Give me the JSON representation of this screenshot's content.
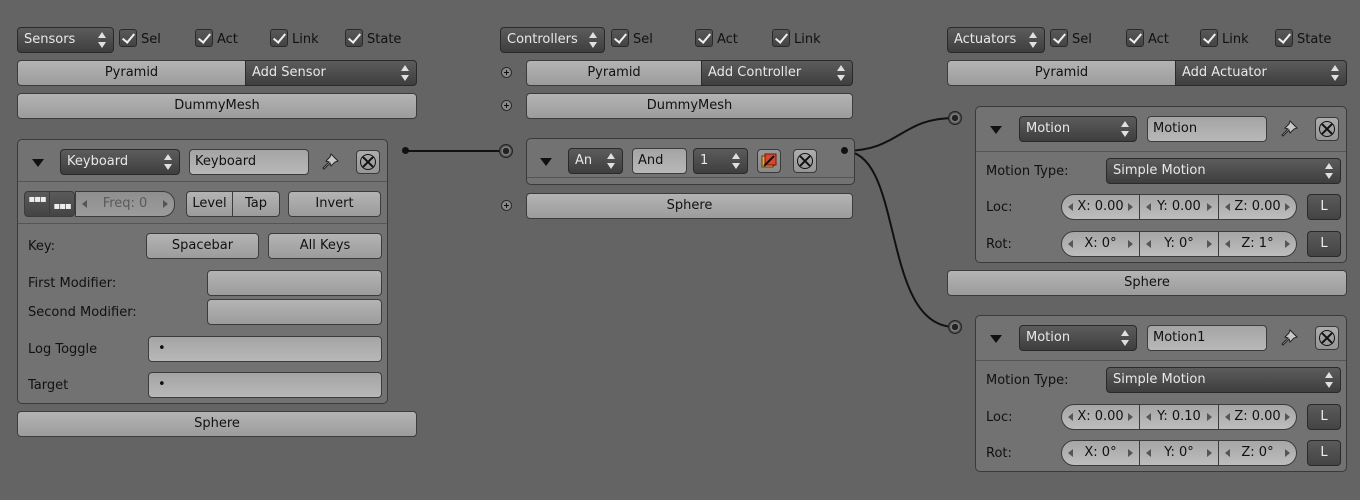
{
  "sensors": {
    "menu": "Sensors",
    "filters": [
      "Sel",
      "Act",
      "Link",
      "State"
    ],
    "object_name": "Pyramid",
    "add_menu": "Add Sensor",
    "object2": "DummyMesh",
    "object3": "Sphere",
    "brick": {
      "type": "Keyboard",
      "name": "Keyboard",
      "freq": "Freq: 0",
      "level": "Level",
      "tap": "Tap",
      "invert": "Invert",
      "key_label": "Key:",
      "key_value": "Spacebar",
      "all_keys": "All Keys",
      "first_modifier": "First Modifier:",
      "second_modifier": "Second Modifier:",
      "log_toggle": "Log Toggle",
      "target": "Target",
      "bullet": "•"
    }
  },
  "controllers": {
    "menu": "Controllers",
    "filters": [
      "Sel",
      "Act",
      "Link"
    ],
    "object_name": "Pyramid",
    "add_menu": "Add Controller",
    "object2": "DummyMesh",
    "object3": "Sphere",
    "brick": {
      "type": "An",
      "name": "And",
      "state": "1"
    }
  },
  "actuators": {
    "menu": "Actuators",
    "filters": [
      "Sel",
      "Act",
      "Link",
      "State"
    ],
    "object_name": "Pyramid",
    "add_menu": "Add Actuator",
    "object2": "Sphere",
    "bricks": [
      {
        "type": "Motion",
        "name": "Motion",
        "motion_type_label": "Motion Type:",
        "motion_type": "Simple Motion",
        "loc_label": "Loc:",
        "loc": [
          "X: 0.00",
          "Y: 0.00",
          "Z: 0.00"
        ],
        "rot_label": "Rot:",
        "rot": [
          "X: 0°",
          "Y: 0°",
          "Z: 1°"
        ],
        "local": "L"
      },
      {
        "type": "Motion",
        "name": "Motion1",
        "motion_type_label": "Motion Type:",
        "motion_type": "Simple Motion",
        "loc_label": "Loc:",
        "loc": [
          "X: 0.00",
          "Y: 0.10",
          "Z: 0.00"
        ],
        "rot_label": "Rot:",
        "rot": [
          "X: 0°",
          "Y: 0°",
          "Z: 0°"
        ],
        "local": "L"
      }
    ]
  }
}
